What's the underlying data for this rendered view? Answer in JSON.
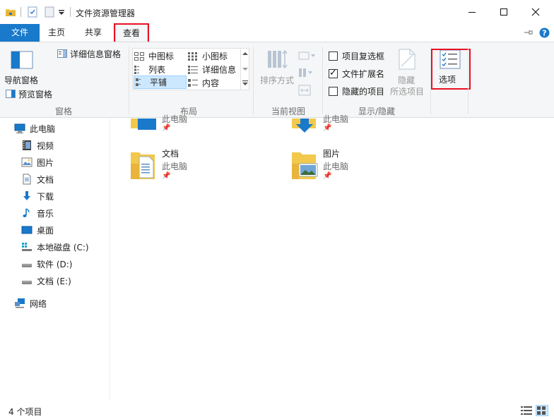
{
  "window": {
    "title": "文件资源管理器",
    "minimize": "—",
    "maximize": "☐",
    "close": "✕"
  },
  "tabs": [
    {
      "label": "文件"
    },
    {
      "label": "主页"
    },
    {
      "label": "共享"
    },
    {
      "label": "查看"
    }
  ],
  "ribbon": {
    "panes": {
      "label": "窗格",
      "nav_pane": "导航窗格",
      "preview_pane": "预览窗格",
      "details_pane": "详细信息窗格"
    },
    "layout": {
      "label": "布局",
      "medium_icons": "中图标",
      "small_icons": "小图标",
      "list": "列表",
      "details": "详细信息",
      "tiles": "平铺",
      "content": "内容"
    },
    "current_view": {
      "label": "当前视图",
      "sort_by": "排序方式"
    },
    "show_hide": {
      "label": "显示/隐藏",
      "item_checkboxes": "项目复选框",
      "file_extensions": "文件扩展名",
      "hidden_items": "隐藏的项目",
      "hide_selected_line1": "隐藏",
      "hide_selected_line2": "所选项目",
      "item_checkboxes_checked": false,
      "file_extensions_checked": true,
      "hidden_items_checked": false
    },
    "options": "选项"
  },
  "nav": {
    "items": [
      {
        "label": "此电脑"
      },
      {
        "label": "视频"
      },
      {
        "label": "图片"
      },
      {
        "label": "文档"
      },
      {
        "label": "下载"
      },
      {
        "label": "音乐"
      },
      {
        "label": "桌面"
      },
      {
        "label": "本地磁盘 (C:)"
      },
      {
        "label": "软件 (D:)"
      },
      {
        "label": "文档 (E:)"
      },
      {
        "label": "网络"
      }
    ]
  },
  "content": {
    "tiles": [
      {
        "name": "",
        "location": "此电脑"
      },
      {
        "name": "",
        "location": "此电脑"
      },
      {
        "name": "文档",
        "location": "此电脑"
      },
      {
        "name": "图片",
        "location": "此电脑"
      }
    ]
  },
  "status": {
    "item_count": "4 个项目"
  },
  "colors": {
    "accent": "#1979ca",
    "highlight": "#e81123",
    "selected": "#cce8ff"
  }
}
